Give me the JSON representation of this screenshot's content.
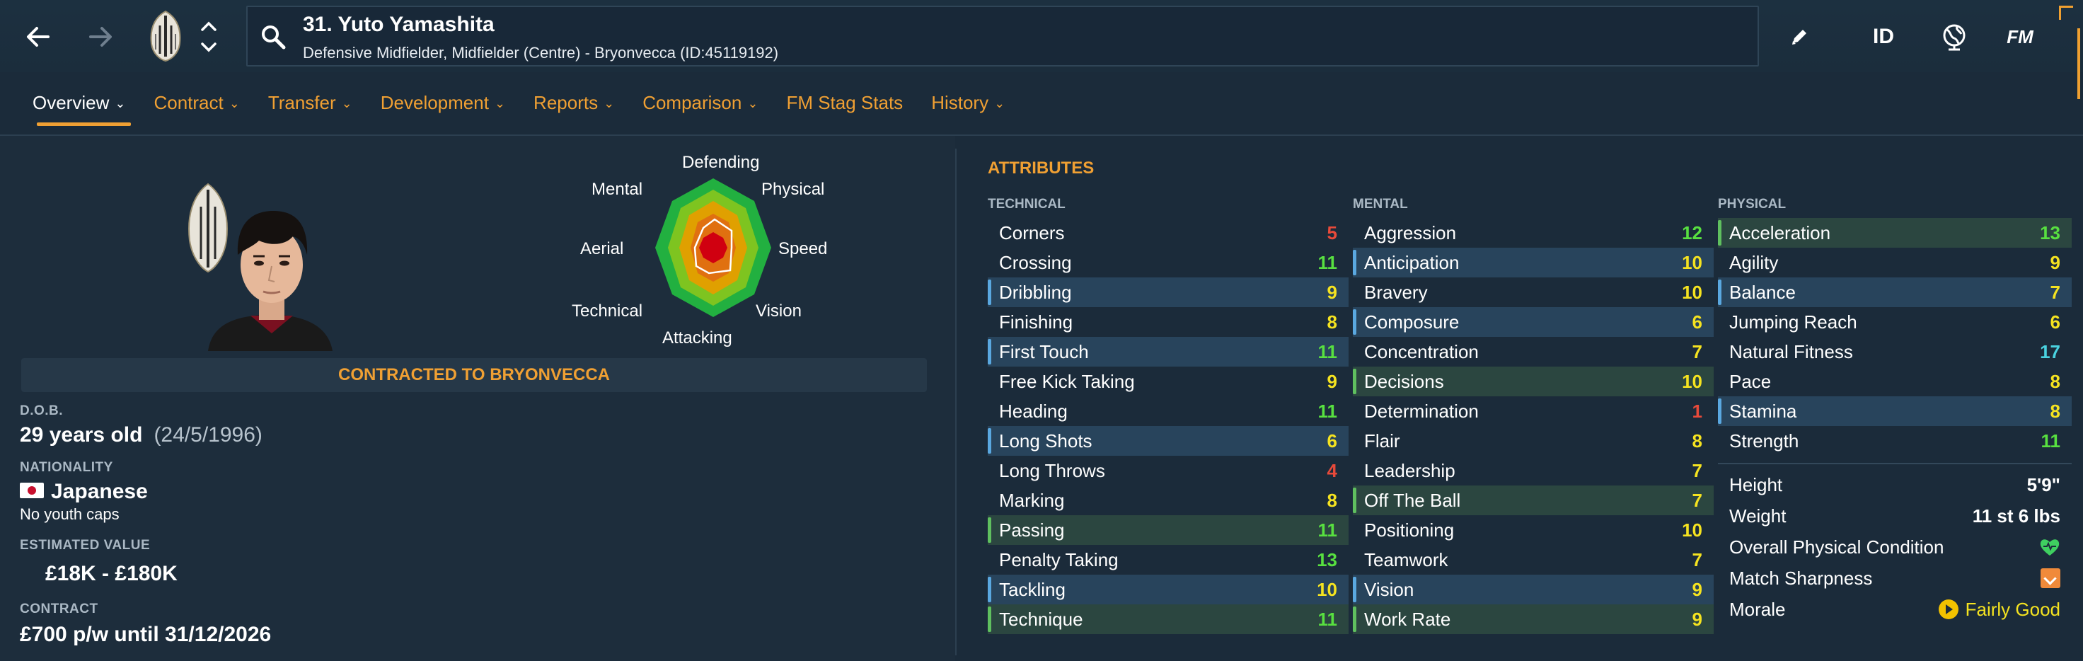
{
  "header": {
    "player_title": "31. Yuto Yamashita",
    "player_subtitle": "Defensive Midfielder, Midfielder (Centre) - Bryonvecca (ID:45119192)",
    "id_label": "ID",
    "fm_label": "FM",
    "icons": [
      "back-arrow-icon",
      "forward-arrow-icon",
      "club-crest-icon",
      "chevron-up-down-icon",
      "search-icon",
      "edit-icon",
      "globe-icon"
    ]
  },
  "tabs": [
    {
      "label": "Overview",
      "dropdown": true,
      "active": true
    },
    {
      "label": "Contract",
      "dropdown": true
    },
    {
      "label": "Transfer",
      "dropdown": true
    },
    {
      "label": "Development",
      "dropdown": true
    },
    {
      "label": "Reports",
      "dropdown": true
    },
    {
      "label": "Comparison",
      "dropdown": true
    },
    {
      "label": "FM Stag Stats",
      "dropdown": false
    },
    {
      "label": "History",
      "dropdown": true
    }
  ],
  "radar": {
    "labels": {
      "defending": "Defending",
      "physical": "Physical",
      "speed": "Speed",
      "vision": "Vision",
      "attacking": "Attacking",
      "technical": "Technical",
      "aerial": "Aerial",
      "mental": "Mental"
    }
  },
  "profile": {
    "contract_banner": "CONTRACTED TO BRYONVECCA",
    "dob_label": "D.O.B.",
    "age": "29 years old",
    "dob": "(24/5/1996)",
    "nationality_label": "NATIONALITY",
    "nationality": "Japanese",
    "youth_caps": "No youth caps",
    "value_label": "ESTIMATED VALUE",
    "value": "£18K - £180K",
    "contract_label": "CONTRACT",
    "contract": "£700 p/w until 31/12/2026"
  },
  "attributes": {
    "title": "ATTRIBUTES",
    "technical_label": "TECHNICAL",
    "mental_label": "MENTAL",
    "physical_label": "PHYSICAL",
    "technical": [
      {
        "name": "Corners",
        "value": "5",
        "color": "red",
        "hl": ""
      },
      {
        "name": "Crossing",
        "value": "11",
        "color": "green",
        "hl": ""
      },
      {
        "name": "Dribbling",
        "value": "9",
        "color": "yellow",
        "hl": "blue"
      },
      {
        "name": "Finishing",
        "value": "8",
        "color": "yellow",
        "hl": ""
      },
      {
        "name": "First Touch",
        "value": "11",
        "color": "green",
        "hl": "blue"
      },
      {
        "name": "Free Kick Taking",
        "value": "9",
        "color": "yellow",
        "hl": ""
      },
      {
        "name": "Heading",
        "value": "11",
        "color": "green",
        "hl": ""
      },
      {
        "name": "Long Shots",
        "value": "6",
        "color": "yellow",
        "hl": "blue"
      },
      {
        "name": "Long Throws",
        "value": "4",
        "color": "red",
        "hl": ""
      },
      {
        "name": "Marking",
        "value": "8",
        "color": "yellow",
        "hl": ""
      },
      {
        "name": "Passing",
        "value": "11",
        "color": "green",
        "hl": "green"
      },
      {
        "name": "Penalty Taking",
        "value": "13",
        "color": "green",
        "hl": ""
      },
      {
        "name": "Tackling",
        "value": "10",
        "color": "yellow",
        "hl": "blue"
      },
      {
        "name": "Technique",
        "value": "11",
        "color": "green",
        "hl": "green"
      }
    ],
    "mental": [
      {
        "name": "Aggression",
        "value": "12",
        "color": "green",
        "hl": ""
      },
      {
        "name": "Anticipation",
        "value": "10",
        "color": "yellow",
        "hl": "blue"
      },
      {
        "name": "Bravery",
        "value": "10",
        "color": "yellow",
        "hl": ""
      },
      {
        "name": "Composure",
        "value": "6",
        "color": "yellow",
        "hl": "blue"
      },
      {
        "name": "Concentration",
        "value": "7",
        "color": "yellow",
        "hl": ""
      },
      {
        "name": "Decisions",
        "value": "10",
        "color": "yellow",
        "hl": "green"
      },
      {
        "name": "Determination",
        "value": "1",
        "color": "red",
        "hl": ""
      },
      {
        "name": "Flair",
        "value": "8",
        "color": "yellow",
        "hl": ""
      },
      {
        "name": "Leadership",
        "value": "7",
        "color": "yellow",
        "hl": ""
      },
      {
        "name": "Off The Ball",
        "value": "7",
        "color": "yellow",
        "hl": "green"
      },
      {
        "name": "Positioning",
        "value": "10",
        "color": "yellow",
        "hl": ""
      },
      {
        "name": "Teamwork",
        "value": "7",
        "color": "yellow",
        "hl": ""
      },
      {
        "name": "Vision",
        "value": "9",
        "color": "yellow",
        "hl": "blue"
      },
      {
        "name": "Work Rate",
        "value": "9",
        "color": "yellow",
        "hl": "green"
      }
    ],
    "physical": [
      {
        "name": "Acceleration",
        "value": "13",
        "color": "green",
        "hl": "green"
      },
      {
        "name": "Agility",
        "value": "9",
        "color": "yellow",
        "hl": ""
      },
      {
        "name": "Balance",
        "value": "7",
        "color": "yellow",
        "hl": "blue"
      },
      {
        "name": "Jumping Reach",
        "value": "6",
        "color": "yellow",
        "hl": ""
      },
      {
        "name": "Natural Fitness",
        "value": "17",
        "color": "teal",
        "hl": ""
      },
      {
        "name": "Pace",
        "value": "8",
        "color": "yellow",
        "hl": ""
      },
      {
        "name": "Stamina",
        "value": "8",
        "color": "yellow",
        "hl": "blue"
      },
      {
        "name": "Strength",
        "value": "11",
        "color": "green",
        "hl": ""
      }
    ],
    "info": {
      "height_label": "Height",
      "height": "5'9\"",
      "weight_label": "Weight",
      "weight": "11 st 6 lbs",
      "condition_label": "Overall Physical Condition",
      "sharpness_label": "Match Sharpness",
      "morale_label": "Morale",
      "morale": "Fairly Good"
    }
  },
  "colors": {
    "accent": "#f0a033",
    "background": "#1b2b3a",
    "red": "#e84a3a",
    "yellow": "#f5e320",
    "green": "#58e040",
    "teal": "#4ad2e0"
  }
}
